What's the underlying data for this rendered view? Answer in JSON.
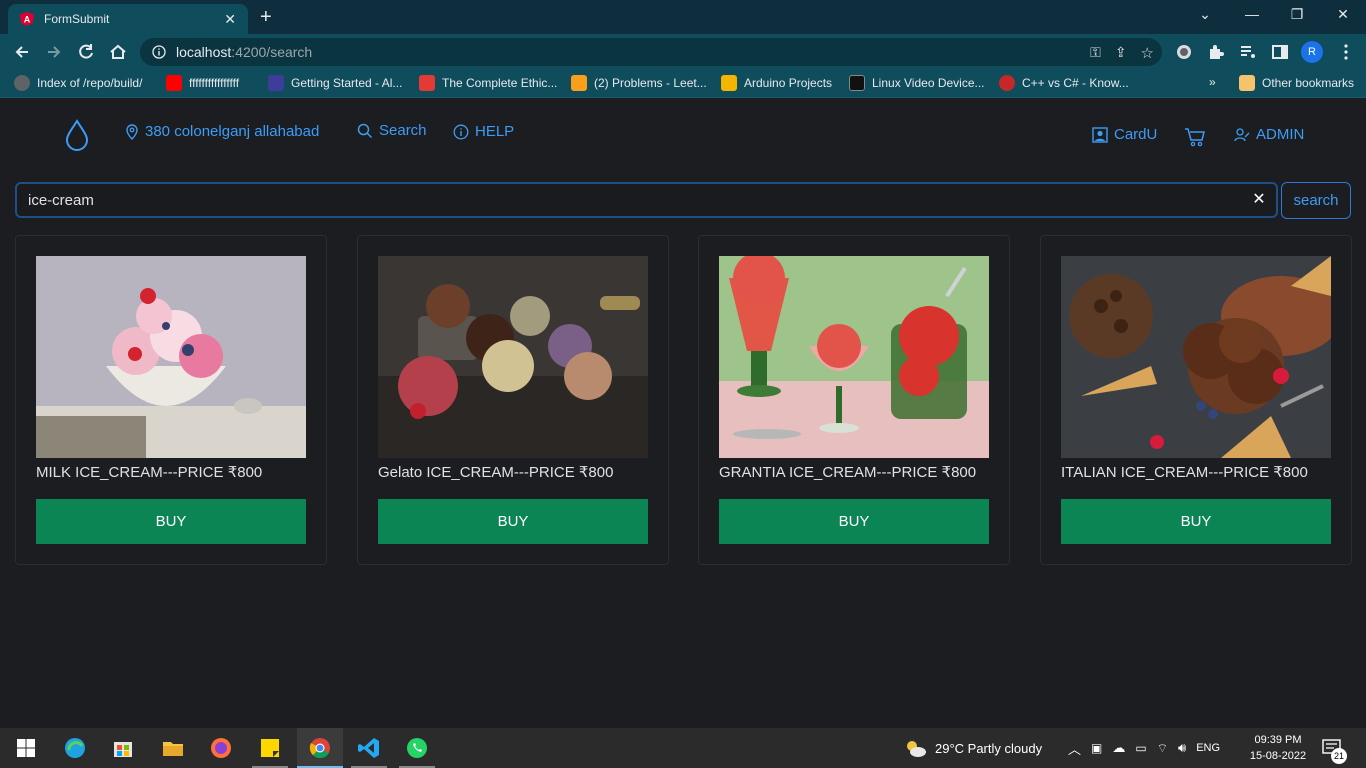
{
  "browser": {
    "tab_title": "FormSubmit",
    "url_host": "localhost",
    "url_path": ":4200/search",
    "profile_initial": "R"
  },
  "bookmarks": [
    {
      "label": "Index of /repo/build/",
      "color": "#5f6368"
    },
    {
      "label": "ffffffffffffffff",
      "color": "#ff0000"
    },
    {
      "label": "Getting Started - Al...",
      "color": "#3f3d99"
    },
    {
      "label": "The Complete Ethic...",
      "color": "#e53935"
    },
    {
      "label": "(2) Problems - Leet...",
      "color": "#f89f1b"
    },
    {
      "label": "Arduino Projects",
      "color": "#f4b400"
    },
    {
      "label": "Linux Video Device...",
      "color": "#111111"
    },
    {
      "label": "C++ vs C# - Know...",
      "color": "#c62828"
    }
  ],
  "bookmarks_more": "»",
  "bookmarks_other": "Other bookmarks",
  "nav": {
    "location": "380 colonelganj allahabad",
    "search": "Search",
    "help": "HELP",
    "card": "CardU",
    "admin": "ADMIN"
  },
  "search": {
    "value": "ice-cream",
    "button": "search",
    "clear": "✕"
  },
  "products": [
    {
      "title": "MILK ICE_CREAM---PRICE ₹800",
      "buy": "BUY"
    },
    {
      "title": "Gelato ICE_CREAM---PRICE ₹800",
      "buy": "BUY"
    },
    {
      "title": "GRANTIA ICE_CREAM---PRICE ₹800",
      "buy": "BUY"
    },
    {
      "title": "ITALIAN ICE_CREAM---PRICE ₹800",
      "buy": "BUY"
    }
  ],
  "taskbar": {
    "weather": "29°C  Partly cloudy",
    "lang": "ENG",
    "time": "09:39 PM",
    "date": "15-08-2022",
    "notifications": "21"
  },
  "colors": {
    "accent": "#3d9cf5",
    "buy": "#0b8553",
    "background": "#1b1d20"
  }
}
